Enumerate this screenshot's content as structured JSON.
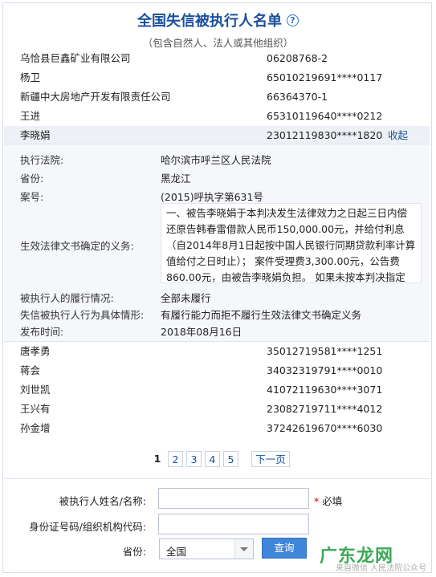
{
  "page": {
    "title": "全国失信被执行人名单",
    "subtitle": "（包含自然人、法人或其他组织）",
    "help_glyph": "?"
  },
  "rows_top": [
    {
      "name": "乌恰县巨鑫矿业有限公司",
      "code": "06208768-2"
    },
    {
      "name": "杨卫",
      "code": "65010219691****0117"
    },
    {
      "name": "新疆中大房地产开发有限责任公司",
      "code": "66364370-1"
    },
    {
      "name": "王进",
      "code": "65310119640****0212"
    },
    {
      "name": "李晓娟",
      "code": "23012119830****1820",
      "collapse": "收起"
    }
  ],
  "detail": {
    "court_label": "执行法院:",
    "court": "哈尔滨市呼兰区人民法院",
    "province_label": "省份:",
    "province": "黑龙江",
    "case_label": "案号:",
    "case": "(2015)呼执字第631号",
    "duty_label": "生效法律文书确定的义务:",
    "duty": "一、被告李晓娟于本判决发生法律效力之日起三日内偿还原告韩春雷借款人民币150,000.00元，并给付利息（自2014年8月1日起按中国人民银行同期贷款利率计算值给付之日时止）； 案件受理费3,300.00元，公告费860.00元，由被告李晓娟负担。 如果未按本判决指定",
    "perf_label": "被执行人的履行情况:",
    "perf": "全部未履行",
    "behav_label": "失信被执行人行为具体情形:",
    "behav": "有履行能力而拒不履行生效法律文书确定义务",
    "pub_label": "发布时间:",
    "pub": "2018年08月16日"
  },
  "rows_bottom": [
    {
      "name": "唐孝勇",
      "code": "35012719581****1251"
    },
    {
      "name": "蒋会",
      "code": "34032319791****0010"
    },
    {
      "name": "刘世凯",
      "code": "41072119630****3071"
    },
    {
      "name": "王兴有",
      "code": "23082719711****4012"
    },
    {
      "name": "孙金增",
      "code": "37242619670****6030"
    }
  ],
  "pager": {
    "pages": [
      "1",
      "2",
      "3",
      "4",
      "5"
    ],
    "current": "1",
    "next": "下一页"
  },
  "form": {
    "name_label": "被执行人姓名/名称:",
    "required_mark": "*",
    "required_text": "必填",
    "id_label": "身份证号码/组织机构代码:",
    "province_label": "省份:",
    "province_value": "全国",
    "submit": "查询"
  },
  "watermark": {
    "brand": "广东龙网",
    "sub": "来自微信 人民法院公众号"
  }
}
